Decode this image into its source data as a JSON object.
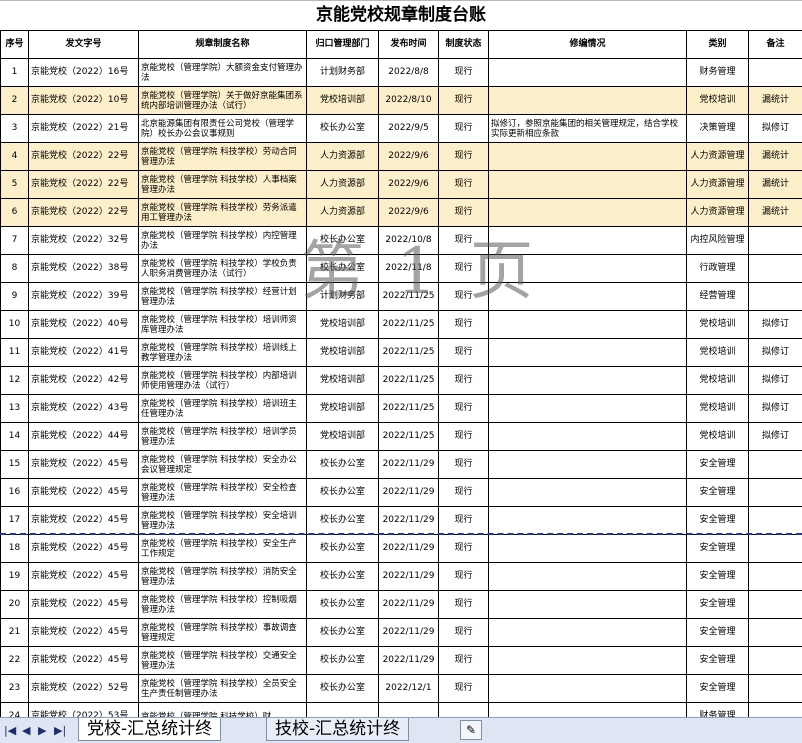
{
  "title": "京能党校规章制度台账",
  "headers": [
    "序号",
    "发文字号",
    "规章制度名称",
    "归口管理部门",
    "发布时间",
    "制度状态",
    "修编情况",
    "类别",
    "备注"
  ],
  "rows": [
    {
      "no": "1",
      "doc": "京能党校（2022）16号",
      "name": "京能党校（管理学院）大额资金支付管理办法",
      "dept": "计划财务部",
      "date": "2022/8/8",
      "status": "现行",
      "revision": "",
      "category": "财务管理",
      "remark": "",
      "hl": false
    },
    {
      "no": "2",
      "doc": "京能党校（2022）10号",
      "name": "京能党校（管理学院）关于做好京能集团系统内部培训管理办法（试行）",
      "dept": "党校培训部",
      "date": "2022/8/10",
      "status": "现行",
      "revision": "",
      "category": "党校培训",
      "remark": "漏统计",
      "hl": true
    },
    {
      "no": "3",
      "doc": "京能党校（2022）21号",
      "name": "北京能源集团有限责任公司党校（管理学院）校长办公会议事规则",
      "dept": "校长办公室",
      "date": "2022/9/5",
      "status": "现行",
      "revision": "拟修订，参照京能集团的相关管理规定，结合学校实际更新相应条款",
      "category": "决策管理",
      "remark": "拟修订",
      "hl": false
    },
    {
      "no": "4",
      "doc": "京能党校（2022）22号",
      "name": "京能党校（管理学院 科技学校）劳动合同管理办法",
      "dept": "人力资源部",
      "date": "2022/9/6",
      "status": "现行",
      "revision": "",
      "category": "人力资源管理",
      "remark": "漏统计",
      "hl": true
    },
    {
      "no": "5",
      "doc": "京能党校（2022）22号",
      "name": "京能党校（管理学院 科技学校）人事档案管理办法",
      "dept": "人力资源部",
      "date": "2022/9/6",
      "status": "现行",
      "revision": "",
      "category": "人力资源管理",
      "remark": "漏统计",
      "hl": true
    },
    {
      "no": "6",
      "doc": "京能党校（2022）22号",
      "name": "京能党校（管理学院 科技学校）劳务派遣用工管理办法",
      "dept": "人力资源部",
      "date": "2022/9/6",
      "status": "现行",
      "revision": "",
      "category": "人力资源管理",
      "remark": "漏统计",
      "hl": true
    },
    {
      "no": "7",
      "doc": "京能党校（2022）32号",
      "name": "京能党校（管理学院 科技学校）内控管理办法",
      "dept": "校长办公室",
      "date": "2022/10/8",
      "status": "现行",
      "revision": "",
      "category": "内控风险管理",
      "remark": "",
      "hl": false
    },
    {
      "no": "8",
      "doc": "京能党校（2022）38号",
      "name": "京能党校（管理学院 科技学校）学校负责人职务消费管理办法（试行）",
      "dept": "校长办公室",
      "date": "2022/11/8",
      "status": "现行",
      "revision": "",
      "category": "行政管理",
      "remark": "",
      "hl": false
    },
    {
      "no": "9",
      "doc": "京能党校（2022）39号",
      "name": "京能党校（管理学院 科技学校）经营计划管理办法",
      "dept": "计划财务部",
      "date": "2022/11/25",
      "status": "现行",
      "revision": "",
      "category": "经营管理",
      "remark": "",
      "hl": false
    },
    {
      "no": "10",
      "doc": "京能党校（2022）40号",
      "name": "京能党校（管理学院 科技学校）培训师资库管理办法",
      "dept": "党校培训部",
      "date": "2022/11/25",
      "status": "现行",
      "revision": "",
      "category": "党校培训",
      "remark": "拟修订",
      "hl": false
    },
    {
      "no": "11",
      "doc": "京能党校（2022）41号",
      "name": "京能党校（管理学院 科技学校）培训线上教学管理办法",
      "dept": "党校培训部",
      "date": "2022/11/25",
      "status": "现行",
      "revision": "",
      "category": "党校培训",
      "remark": "拟修订",
      "hl": false
    },
    {
      "no": "12",
      "doc": "京能党校（2022）42号",
      "name": "京能党校（管理学院 科技学校）内部培训师使用管理办法（试行）",
      "dept": "党校培训部",
      "date": "2022/11/25",
      "status": "现行",
      "revision": "",
      "category": "党校培训",
      "remark": "拟修订",
      "hl": false
    },
    {
      "no": "13",
      "doc": "京能党校（2022）43号",
      "name": "京能党校（管理学院 科技学校）培训班主任管理办法",
      "dept": "党校培训部",
      "date": "2022/11/25",
      "status": "现行",
      "revision": "",
      "category": "党校培训",
      "remark": "拟修订",
      "hl": false
    },
    {
      "no": "14",
      "doc": "京能党校（2022）44号",
      "name": "京能党校（管理学院 科技学校）培训学员管理办法",
      "dept": "党校培训部",
      "date": "2022/11/25",
      "status": "现行",
      "revision": "",
      "category": "党校培训",
      "remark": "拟修订",
      "hl": false
    },
    {
      "no": "15",
      "doc": "京能党校（2022）45号",
      "name": "京能党校（管理学院 科技学校）安全办公会议管理规定",
      "dept": "校长办公室",
      "date": "2022/11/29",
      "status": "现行",
      "revision": "",
      "category": "安全管理",
      "remark": "",
      "hl": false
    },
    {
      "no": "16",
      "doc": "京能党校（2022）45号",
      "name": "京能党校（管理学院 科技学校）安全检查管理办法",
      "dept": "校长办公室",
      "date": "2022/11/29",
      "status": "现行",
      "revision": "",
      "category": "安全管理",
      "remark": "",
      "hl": false
    },
    {
      "no": "17",
      "doc": "京能党校（2022）45号",
      "name": "京能党校（管理学院 科技学校）安全培训管理办法",
      "dept": "校长办公室",
      "date": "2022/11/29",
      "status": "现行",
      "revision": "",
      "category": "安全管理",
      "remark": "",
      "hl": false
    },
    {
      "no": "18",
      "doc": "京能党校（2022）45号",
      "name": "京能党校（管理学院 科技学校）安全生产工作规定",
      "dept": "校长办公室",
      "date": "2022/11/29",
      "status": "现行",
      "revision": "",
      "category": "安全管理",
      "remark": "",
      "hl": false
    },
    {
      "no": "19",
      "doc": "京能党校（2022）45号",
      "name": "京能党校（管理学院 科技学校）消防安全管理办法",
      "dept": "校长办公室",
      "date": "2022/11/29",
      "status": "现行",
      "revision": "",
      "category": "安全管理",
      "remark": "",
      "hl": false
    },
    {
      "no": "20",
      "doc": "京能党校（2022）45号",
      "name": "京能党校（管理学院 科技学校）控制吸烟管理办法",
      "dept": "校长办公室",
      "date": "2022/11/29",
      "status": "现行",
      "revision": "",
      "category": "安全管理",
      "remark": "",
      "hl": false
    },
    {
      "no": "21",
      "doc": "京能党校（2022）45号",
      "name": "京能党校（管理学院 科技学校）事故调查管理规定",
      "dept": "校长办公室",
      "date": "2022/11/29",
      "status": "现行",
      "revision": "",
      "category": "安全管理",
      "remark": "",
      "hl": false
    },
    {
      "no": "22",
      "doc": "京能党校（2022）45号",
      "name": "京能党校（管理学院 科技学校）交通安全管理办法",
      "dept": "校长办公室",
      "date": "2022/11/29",
      "status": "现行",
      "revision": "",
      "category": "安全管理",
      "remark": "",
      "hl": false
    },
    {
      "no": "23",
      "doc": "京能党校（2022）52号",
      "name": "京能党校（管理学院 科技学校）全员安全生产责任制管理办法",
      "dept": "校长办公室",
      "date": "2022/12/1",
      "status": "现行",
      "revision": "",
      "category": "安全管理",
      "remark": "",
      "hl": false
    },
    {
      "no": "24",
      "doc": "京能党校（2022）53号",
      "name": "京能党校（管理学院 科技学校）财",
      "dept": "",
      "date": "",
      "status": "",
      "revision": "",
      "category": "财务管理",
      "remark": "",
      "hl": false
    }
  ],
  "watermark": "第 1 页",
  "tabs": {
    "nav_first": "|◀",
    "nav_prev": "◀",
    "nav_next": "▶",
    "nav_last": "▶|",
    "sheet1": "党校-汇总统计终",
    "sheet2": "技校-汇总统计终",
    "new_sheet_icon": "new-sheet-icon"
  },
  "colors": {
    "highlight": "#fdefc9",
    "page_break": "#2233aa"
  }
}
